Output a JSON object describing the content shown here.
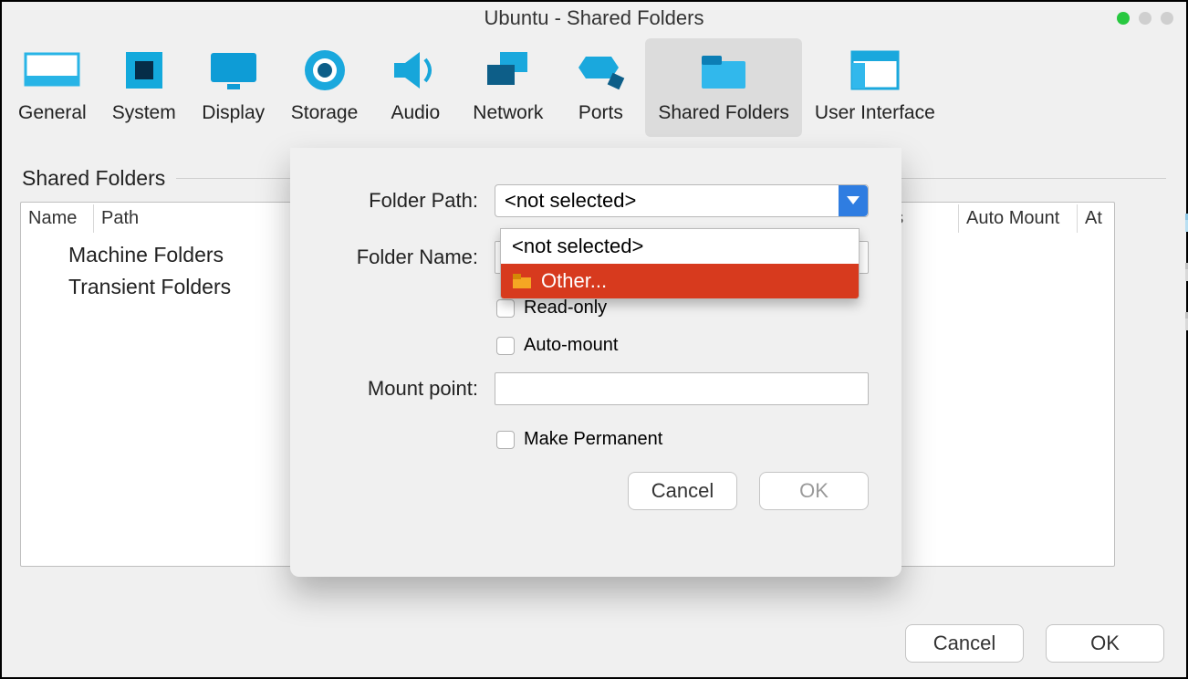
{
  "window": {
    "title": "Ubuntu - Shared Folders"
  },
  "toolbar": {
    "items": [
      {
        "id": "general",
        "label": "General"
      },
      {
        "id": "system",
        "label": "System"
      },
      {
        "id": "display",
        "label": "Display"
      },
      {
        "id": "storage",
        "label": "Storage"
      },
      {
        "id": "audio",
        "label": "Audio"
      },
      {
        "id": "network",
        "label": "Network"
      },
      {
        "id": "ports",
        "label": "Ports"
      },
      {
        "id": "shared-folders",
        "label": "Shared Folders",
        "active": true
      },
      {
        "id": "user-interface",
        "label": "User Interface"
      }
    ]
  },
  "section": {
    "title": "Shared Folders"
  },
  "table": {
    "columns": {
      "name": "Name",
      "path": "Path",
      "access": "ess",
      "auto_mount": "Auto Mount",
      "at": "At"
    },
    "tree": {
      "machine_folders": "Machine Folders",
      "transient_folders": "Transient Folders"
    }
  },
  "dialog": {
    "labels": {
      "folder_path": "Folder Path:",
      "folder_name": "Folder Name:",
      "mount_point": "Mount point:"
    },
    "combo": {
      "selected": "<not selected>",
      "options": {
        "not_selected": "<not selected>",
        "other": "Other..."
      }
    },
    "checkboxes": {
      "read_only": "Read-only",
      "auto_mount": "Auto-mount",
      "make_permanent": "Make Permanent"
    },
    "buttons": {
      "cancel": "Cancel",
      "ok": "OK"
    },
    "inputs": {
      "folder_name": "",
      "mount_point": ""
    }
  },
  "main_buttons": {
    "cancel": "Cancel",
    "ok": "OK"
  }
}
